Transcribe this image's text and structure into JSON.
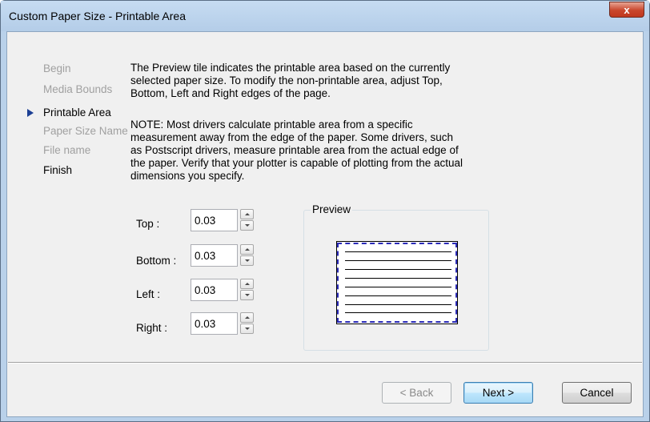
{
  "window": {
    "title": "Custom Paper Size - Printable Area",
    "close_glyph": "x"
  },
  "steps": [
    {
      "label": "Begin",
      "state": "pending"
    },
    {
      "label": "Media Bounds",
      "state": "pending"
    },
    {
      "label": "Printable Area",
      "state": "current"
    },
    {
      "label": "Paper Size Name",
      "state": "pending"
    },
    {
      "label": "File name",
      "state": "pending"
    },
    {
      "label": "Finish",
      "state": "done"
    }
  ],
  "description": {
    "paragraph1": "The Preview tile indicates the printable area based on the currently selected paper size. To modify the non-printable area, adjust Top, Bottom, Left and Right edges of the page.",
    "paragraph2": "NOTE: Most drivers calculate printable area from a specific measurement away from the edge of the paper. Some drivers, such as Postscript drivers, measure printable area from the actual edge of the paper. Verify that your plotter is capable of plotting from the actual dimensions you specify."
  },
  "fields": {
    "top": {
      "label": "Top :",
      "value": "0.03"
    },
    "bottom": {
      "label": "Bottom :",
      "value": "0.03"
    },
    "left": {
      "label": "Left :",
      "value": "0.03"
    },
    "right": {
      "label": "Right :",
      "value": "0.03"
    }
  },
  "preview": {
    "legend": "Preview"
  },
  "buttons": {
    "back": "< Back",
    "next": "Next >",
    "cancel": "Cancel"
  },
  "colors": {
    "accent": "#1c3f94",
    "printable_border": "#2b2bb8",
    "titlebar": "#b9d1ea",
    "close_button": "#c9462c"
  },
  "icons": {
    "current_step": "triangle-right-icon",
    "spin_up": "spin-up-icon",
    "spin_down": "spin-down-icon",
    "close": "close-icon"
  }
}
